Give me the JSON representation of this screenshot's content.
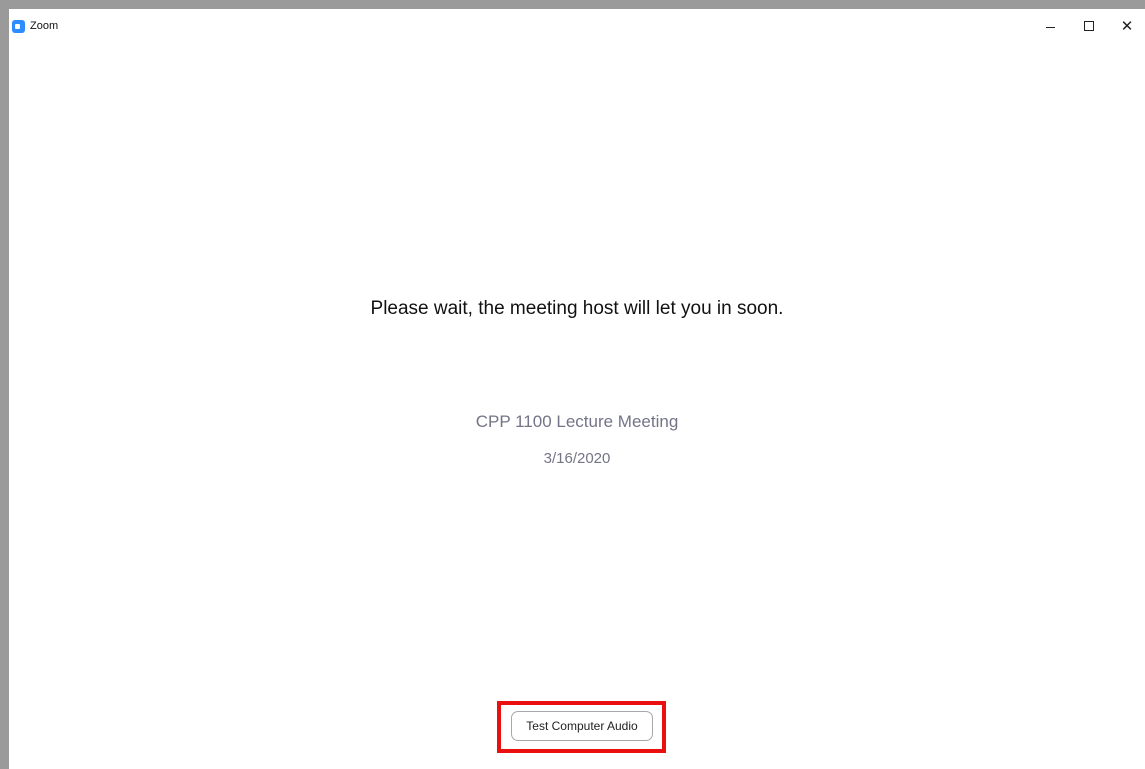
{
  "window": {
    "title": "Zoom",
    "controls": {
      "minimize": "minimize",
      "maximize": "maximize",
      "close": "✕"
    }
  },
  "waiting_room": {
    "message": "Please wait, the meeting host will let you in soon.",
    "meeting_title": "CPP 1100 Lecture Meeting",
    "meeting_date": "3/16/2020",
    "test_audio_label": "Test Computer Audio"
  },
  "icons": {
    "app": "zoom-app-icon",
    "minimize": "minimize-icon",
    "maximize": "maximize-icon",
    "close": "close-icon"
  },
  "colors": {
    "zoom_blue": "#2d8cff",
    "highlight_red": "#ea1010",
    "meeting_info_gray": "#747487"
  }
}
